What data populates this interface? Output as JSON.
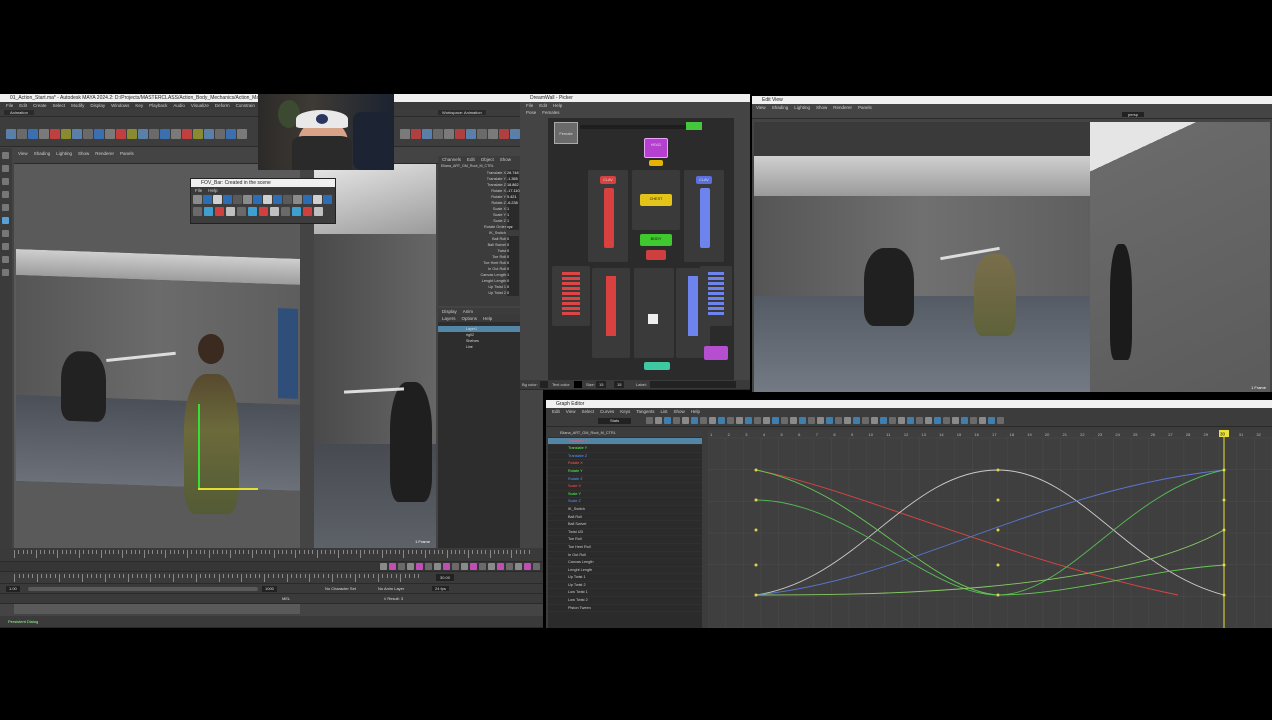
{
  "maya": {
    "title": "01_Action_Start.ma* - Autodesk MAYA 2024.2: D:/Projects/MASTERCLASS/Action_Body_Mechanics/Action_Masterclass/01_Action...",
    "menu": [
      "File",
      "Edit",
      "Create",
      "Select",
      "Modify",
      "Display",
      "Windows",
      "Key",
      "Playback",
      "Audio",
      "Visualize",
      "Deform",
      "Constrain",
      "Control",
      "Cache",
      "Arnold"
    ],
    "mode": "Animation",
    "workspace": "Workspace: Animation",
    "viewport_menu": [
      "View",
      "Shading",
      "Lighting",
      "Show",
      "Renderer",
      "Panels"
    ],
    "status": "Persistent Dialog",
    "time_start": "1.00",
    "time_end": "1000",
    "frame": "30.00",
    "char_set": "No Character Set",
    "anim_layer": "No Anim Layer",
    "fps": "24 fps",
    "mel": "MEL",
    "mel_result": "// Result: 3"
  },
  "floating_tool": {
    "title": "FOV_Bar: Created in the scene",
    "menu": [
      "File",
      "Help"
    ]
  },
  "channel_box": {
    "menu": [
      "Channels",
      "Edit",
      "Object",
      "Show"
    ],
    "object": "Eliana_ART_GM_Root_M_CTRL",
    "channels": [
      "Translate X",
      "Translate Y",
      "Translate Z",
      "Rotate X",
      "Rotate Y",
      "Rotate Z",
      "Scale X",
      "Scale Y",
      "Scale Z",
      "Rotate Order",
      "IK_Switch",
      "Ball Roll",
      "Ball Swivel",
      "Twist",
      "Toe Roll",
      "Toe Heel Roll",
      "In Out Roll",
      "Canvas Length",
      "Lenght Length",
      "Up Twist 1",
      "Up Twist 2"
    ],
    "values": [
      "26.748",
      "-1.365",
      "18.862",
      "-17.110",
      "5.421",
      "-6.238",
      "1",
      "1",
      "1",
      "xyz",
      "",
      "0",
      "0",
      "0",
      "0",
      "0",
      "0",
      "1",
      "0",
      "0",
      "0"
    ],
    "layer_menu": [
      "Display",
      "Anim"
    ],
    "layer_sub": [
      "Layers",
      "Options",
      "Help"
    ],
    "layers": [
      "Layer1",
      "rig02",
      "Shelves",
      "Line"
    ]
  },
  "picker": {
    "title": "DreamWall - Picker",
    "menu": [
      "File",
      "Edit",
      "Help"
    ],
    "tabs": [
      "Pose",
      "Females"
    ],
    "char": "Female",
    "parts": {
      "head": "HEAD",
      "chest": "CHEST",
      "body": "BODY",
      "clav_l": "CLAV",
      "clav_r": "CLAV"
    },
    "bottom_label": "Bg color:",
    "text_label": "Text color:",
    "size_label": "Size:",
    "size_a": "15",
    "size_b": "15",
    "label_label": "Label:"
  },
  "view": {
    "title": "Edit View",
    "menu": [
      "View",
      "Shading",
      "Lighting",
      "Show",
      "Renderer",
      "Panels"
    ],
    "frame_label": "1 Frame",
    "camera": "persp"
  },
  "graph": {
    "title": "Graph Editor",
    "menu": [
      "Edit",
      "View",
      "Select",
      "Curves",
      "Keys",
      "Tangents",
      "List",
      "Show",
      "Help"
    ],
    "stats": "Stats",
    "root": "Eliana_ART_GM_Root_M_CTRL",
    "items": [
      "Translate X",
      "Translate Y",
      "Translate Z",
      "Rotate X",
      "Rotate Y",
      "Rotate Z",
      "Scale X",
      "Scale Y",
      "Scale Z",
      "IK_Switch",
      "Ball Roll",
      "Ball Swivel",
      "Twist UD",
      "Toe Roll",
      "Toe Heel Roll",
      "In Out Roll",
      "Canvas Length",
      "Lenght Length",
      "Up Twist 1",
      "Up Twist 2",
      "Low Twist 1",
      "Low Twist 2",
      "Piston Tween"
    ],
    "colors": [
      "#ff5555",
      "#55ff55",
      "#5599ff",
      "#ff5555",
      "#55ff55",
      "#5599ff",
      "#ff5555",
      "#55ff55",
      "#5599ff",
      "#cccccc",
      "#cccccc",
      "#cccccc",
      "#cccccc",
      "#cccccc",
      "#cccccc",
      "#cccccc",
      "#cccccc",
      "#cccccc",
      "#cccccc",
      "#cccccc",
      "#cccccc",
      "#cccccc",
      "#cccccc"
    ],
    "ruler": [
      "1",
      "2",
      "3",
      "4",
      "5",
      "6",
      "7",
      "8",
      "9",
      "10",
      "11",
      "12",
      "13",
      "14",
      "15",
      "16",
      "17",
      "18",
      "19",
      "20",
      "21",
      "22",
      "23",
      "24",
      "25",
      "26",
      "27",
      "28",
      "29",
      "30",
      "31",
      "32"
    ],
    "current": "30"
  }
}
